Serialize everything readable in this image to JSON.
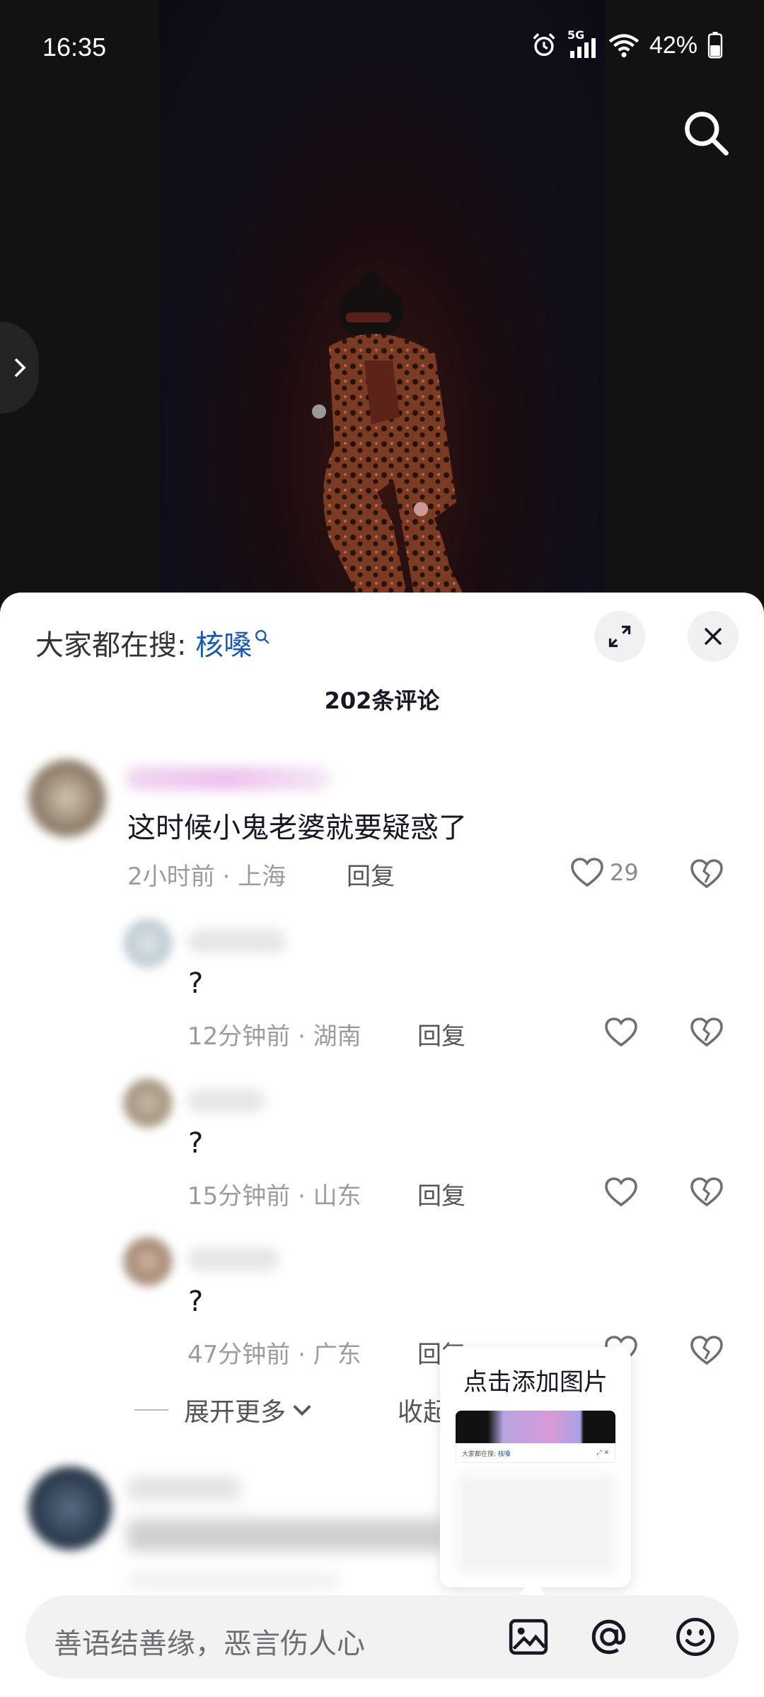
{
  "status_bar": {
    "time": "16:35",
    "network": "5G",
    "battery": "42%"
  },
  "sheet": {
    "search_prefix": "大家都在搜: ",
    "search_keyword": "核嗓",
    "title": "202条评论"
  },
  "comments": [
    {
      "text": "这时候小鬼老婆就要疑惑了",
      "meta": "2小时前 · 上海",
      "reply": "回复",
      "likes": "29"
    },
    {
      "text": "?",
      "meta": "12分钟前 · 湖南",
      "reply": "回复"
    },
    {
      "text": "?",
      "meta": "15分钟前 · 山东",
      "reply": "回复"
    },
    {
      "text": "?",
      "meta": "47分钟前 · 广东",
      "reply": "回复"
    }
  ],
  "thread": {
    "expand_label": "展开更多",
    "collapse_label": "收起"
  },
  "tooltip": {
    "title": "点击添加图片",
    "mini_prefix": "大家都在搜: ",
    "mini_keyword": "核嗓"
  },
  "input": {
    "placeholder": "善语结善缘，恶言伤人心"
  },
  "icons": [
    "alarm-icon",
    "signal-icon",
    "wifi-icon",
    "battery-icon",
    "search-icon",
    "chevron-right-icon",
    "expand-icon",
    "close-icon",
    "heart-icon",
    "broken-heart-icon",
    "chevron-down-icon",
    "image-icon",
    "at-icon",
    "emoji-icon"
  ]
}
